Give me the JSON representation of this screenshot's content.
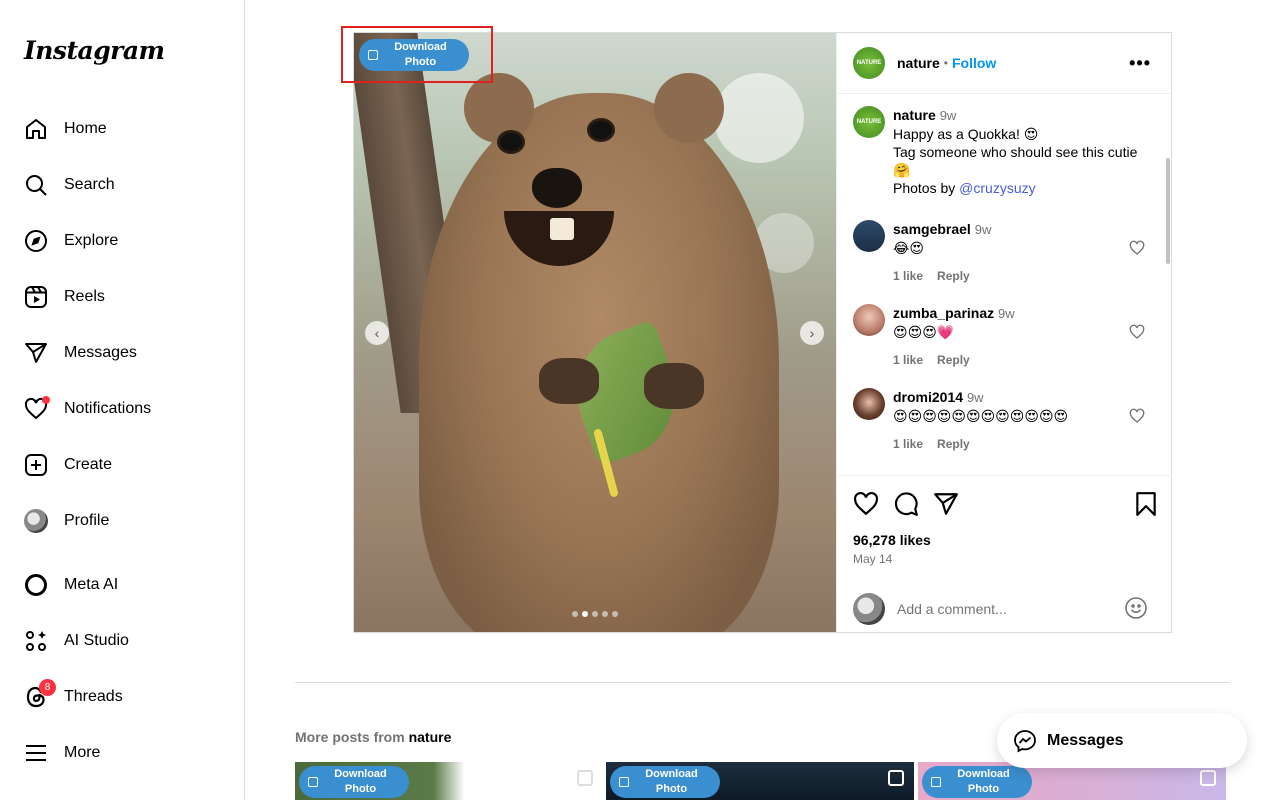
{
  "sidebar": {
    "logo": "Instagram",
    "items": [
      {
        "label": "Home",
        "icon": "home-icon"
      },
      {
        "label": "Search",
        "icon": "search-icon"
      },
      {
        "label": "Explore",
        "icon": "compass-icon"
      },
      {
        "label": "Reels",
        "icon": "reels-icon"
      },
      {
        "label": "Messages",
        "icon": "send-icon"
      },
      {
        "label": "Notifications",
        "icon": "heart-icon"
      },
      {
        "label": "Create",
        "icon": "plus-square-icon"
      },
      {
        "label": "Profile",
        "icon": "avatar"
      },
      {
        "label": "Meta AI",
        "icon": "meta-ai-icon"
      },
      {
        "label": "AI Studio",
        "icon": "ai-studio-icon"
      },
      {
        "label": "Threads",
        "icon": "threads-icon",
        "badge": "8"
      },
      {
        "label": "More",
        "icon": "menu-icon"
      }
    ]
  },
  "post": {
    "download_label_1": "Download",
    "download_label_2": "Photo",
    "carousel_index": 2,
    "carousel_total": 5,
    "author": "nature",
    "separator": "•",
    "follow_label": "Follow",
    "caption": {
      "author": "nature",
      "time": "9w",
      "line1": "Happy as a Quokka! 😍",
      "line2": "Tag someone who should see this cutie",
      "line3": "🤗",
      "line4_prefix": "Photos by ",
      "mention": "@cruzysuzy"
    },
    "comments": [
      {
        "user": "samgebrael",
        "time": "9w",
        "text": "😂😍",
        "likes": "1 like",
        "reply": "Reply"
      },
      {
        "user": "zumba_parinaz",
        "time": "9w",
        "text": "😍😍😍💗",
        "likes": "1 like",
        "reply": "Reply"
      },
      {
        "user": "dromi2014",
        "time": "9w",
        "text": "😍😍😍😍😍😍😍😍😍😍😍😍",
        "likes": "1 like",
        "reply": "Reply"
      }
    ],
    "likes": "96,278 likes",
    "date": "May 14",
    "comment_placeholder": "Add a comment..."
  },
  "more_posts": {
    "prefix": "More posts from ",
    "author": "nature"
  },
  "messages_pill": {
    "label": "Messages"
  },
  "colors": {
    "accent": "#0095f6",
    "badge": "#ff3040",
    "download": "#3a8fd0",
    "highlight": "#e0221e"
  }
}
